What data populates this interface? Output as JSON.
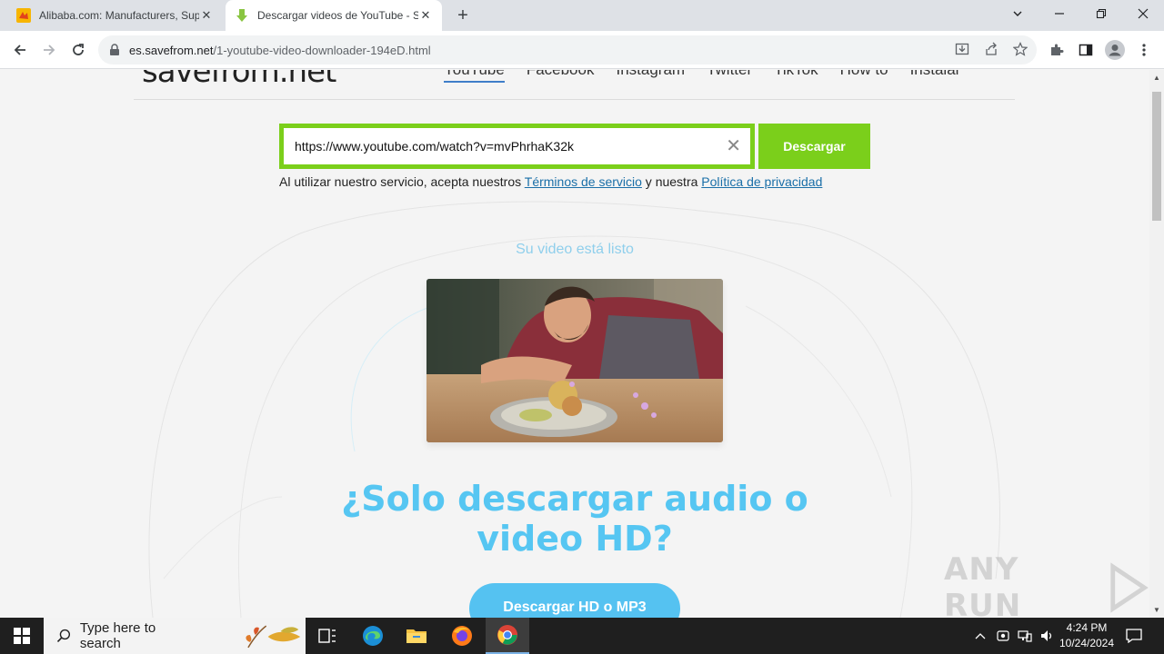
{
  "browser": {
    "tabs": [
      {
        "title": "Alibaba.com: Manufacturers, Suppliers",
        "active": false
      },
      {
        "title": "Descargar videos de YouTube - SaveFrom",
        "active": true
      }
    ],
    "new_tab": "+",
    "url_host": "es.savefrom.net",
    "url_path": "/1-youtube-video-downloader-194eD.html"
  },
  "site": {
    "logo": "savefrom.net",
    "nav": [
      "YouTube",
      "Facebook",
      "Instagram",
      "Twitter",
      "TikTok",
      "How to",
      "Instalar"
    ],
    "search_value": "https://www.youtube.com/watch?v=mvPhrhaK32k",
    "download_label": "Descargar",
    "terms_prefix": "Al utilizar nuestro servicio, acepta nuestros ",
    "terms_link": "Términos de servicio",
    "terms_mid": " y nuestra ",
    "privacy_link": "Política de privacidad",
    "ready_text": "Su video está listo",
    "promo_line1": "¿Solo descargar audio o",
    "promo_line2": "video HD?",
    "hd_button": "Descargar HD o MP3",
    "accent_green": "#7bcf1b",
    "accent_blue": "#56c6f2"
  },
  "watermark": "ANY RUN",
  "taskbar": {
    "search_placeholder": "Type here to search",
    "time": "4:24 PM",
    "date": "10/24/2024"
  }
}
